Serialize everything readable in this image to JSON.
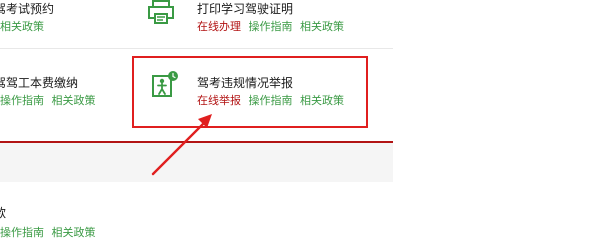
{
  "rows": [
    {
      "left": {
        "title": "驾考试预约",
        "links": [
          "相关政策"
        ]
      },
      "right": {
        "title": "打印学习驾驶证明",
        "links": [
          "在线办理",
          "操作指南",
          "相关政策"
        ]
      }
    },
    {
      "left": {
        "title": "驾驾工本费缴纳",
        "links": [
          "操作指南",
          "相关政策"
        ]
      },
      "right": {
        "title": "驾考违规情况举报",
        "links": [
          "在线举报",
          "操作指南",
          "相关政策"
        ]
      }
    },
    {
      "left": {
        "title": "款",
        "links": [
          "操作指南",
          "相关政策"
        ]
      }
    }
  ],
  "colors": {
    "online_link": "#b21414",
    "normal_link": "#3a9a44",
    "highlight": "#e01f1f",
    "divider_red": "#b21414"
  },
  "icons": {
    "print_icon": "printer-icon",
    "report_icon": "person-exit-icon",
    "annotation_arrow": "arrow-up-right-icon"
  }
}
